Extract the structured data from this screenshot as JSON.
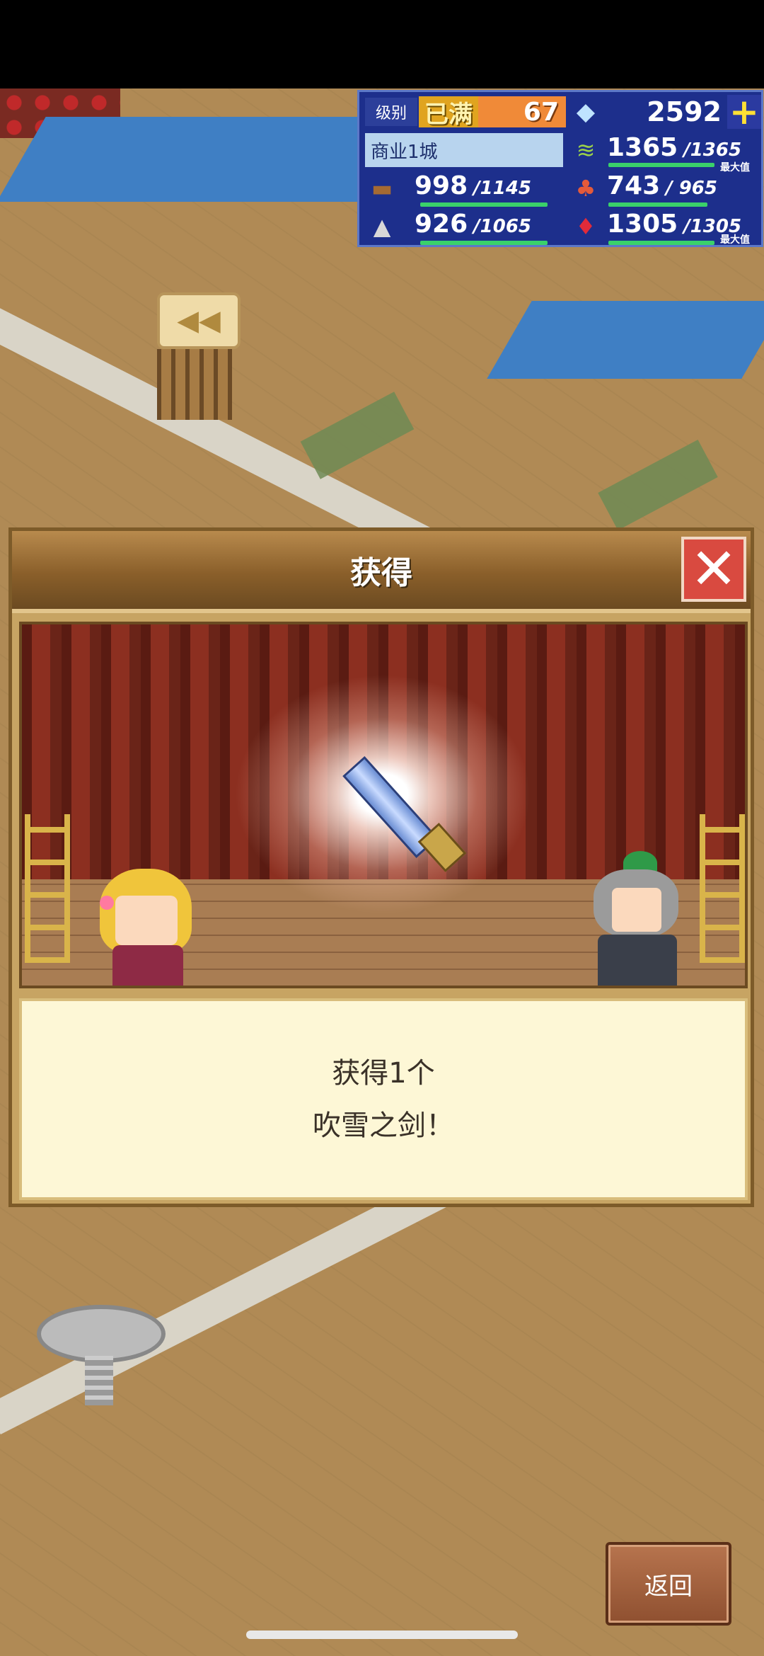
{
  "hud": {
    "level_label": "级别",
    "level_status": "已满",
    "level_value": "67",
    "gems": "2592",
    "plus_icon": "plus-icon",
    "city_name": "商业1城",
    "resources": {
      "food": {
        "value": "1365",
        "cap": "/1365",
        "max_tag": "最大值",
        "icon": "grain-icon",
        "fill": 1.0
      },
      "wood": {
        "value": "998",
        "cap": "/1145",
        "icon": "wood-log-icon",
        "fill": 0.87
      },
      "produce": {
        "value": "743",
        "cap": "/ 965",
        "icon": "vegetables-icon",
        "fill": 0.77
      },
      "stone": {
        "value": "926",
        "cap": "/1065",
        "icon": "stone-icon",
        "fill": 0.87
      },
      "ruby": {
        "value": "1305",
        "cap": "/1305",
        "max_tag": "最大值",
        "icon": "ruby-icon",
        "fill": 1.0
      }
    }
  },
  "dialog": {
    "title": "获得",
    "message_line1": "获得1个",
    "message_line2": "吹雪之剑！",
    "item_icon": "sword-icon"
  },
  "buttons": {
    "back": "返回"
  },
  "colors": {
    "hud_bg": "#1d2f8c",
    "accent_orange": "#f08a38",
    "close_red": "#d94a40",
    "progress_green": "#3ad16a"
  }
}
